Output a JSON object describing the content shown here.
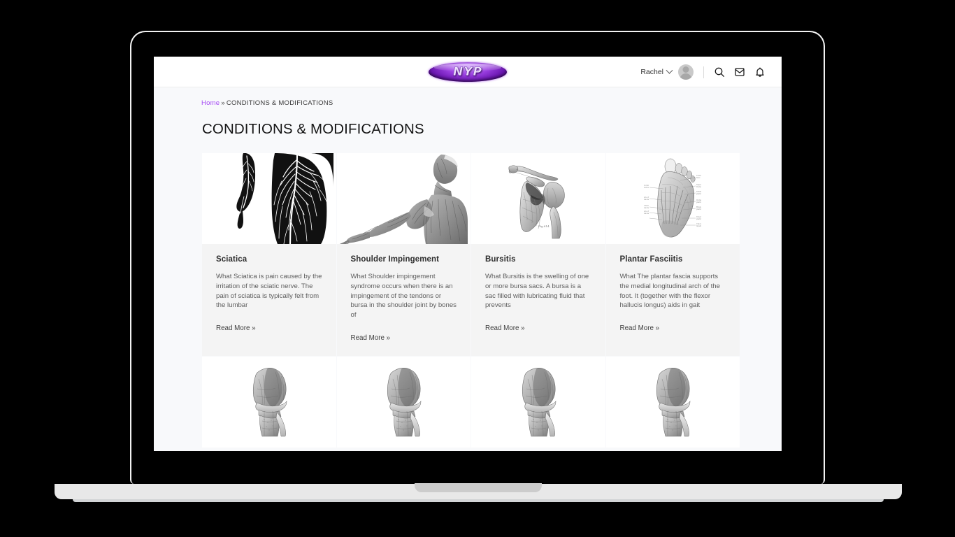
{
  "header": {
    "logo_text": "NYP",
    "logo_name": "nyp-logo",
    "user_name": "Rachel",
    "chevron_icon": "chevron-down-icon",
    "avatar_icon": "user-avatar",
    "search_icon": "search-icon",
    "inbox_icon": "inbox-icon",
    "bell_icon": "bell-icon",
    "accent_color": "#a64bf4"
  },
  "breadcrumb": {
    "home": "Home",
    "separator": "»",
    "current": "CONDITIONS & MODIFICATIONS"
  },
  "page": {
    "title": "CONDITIONS & MODIFICATIONS",
    "background": "#f8f9fb",
    "card_background": "#f4f4f4"
  },
  "cards": [
    {
      "title": "Sciatica",
      "excerpt": "What Sciatica is pain caused by the irritation of the sciatic nerve.  The pain of sciatica is typically felt from the lumbar",
      "read_more": "Read More »",
      "image_name": "sciatica-nerve-anatomy-illustration"
    },
    {
      "title": "Shoulder Impingement",
      "excerpt": "What Shoulder impingement syndrome occurs when there is an impingement of the tendons or bursa in the shoulder joint by bones of",
      "read_more": "Read More »",
      "image_name": "shoulder-muscle-anatomy-illustration"
    },
    {
      "title": "Bursitis",
      "excerpt": "What Bursitis is the swelling of one or more bursa sacs.  A bursa is a sac filled with lubricating fluid that prevents",
      "read_more": "Read More »",
      "image_name": "shoulder-bone-joint-illustration"
    },
    {
      "title": "Plantar Fasciitis",
      "excerpt": "What The plantar fascia supports the medial longitudinal arch of the foot.  It (together with the flexor hallucis longus) aids in gait",
      "read_more": "Read More »",
      "image_name": "plantar-foot-anatomy-illustration"
    }
  ],
  "cards_row2": [
    {
      "image_name": "knee-joint-illustration"
    },
    {
      "image_name": "knee-joint-illustration"
    },
    {
      "image_name": "knee-joint-illustration"
    },
    {
      "image_name": "knee-joint-illustration"
    }
  ],
  "device": {
    "frame": "laptop-mockup",
    "bezel_color": "#000000",
    "base_color": "#e8e8e8"
  }
}
